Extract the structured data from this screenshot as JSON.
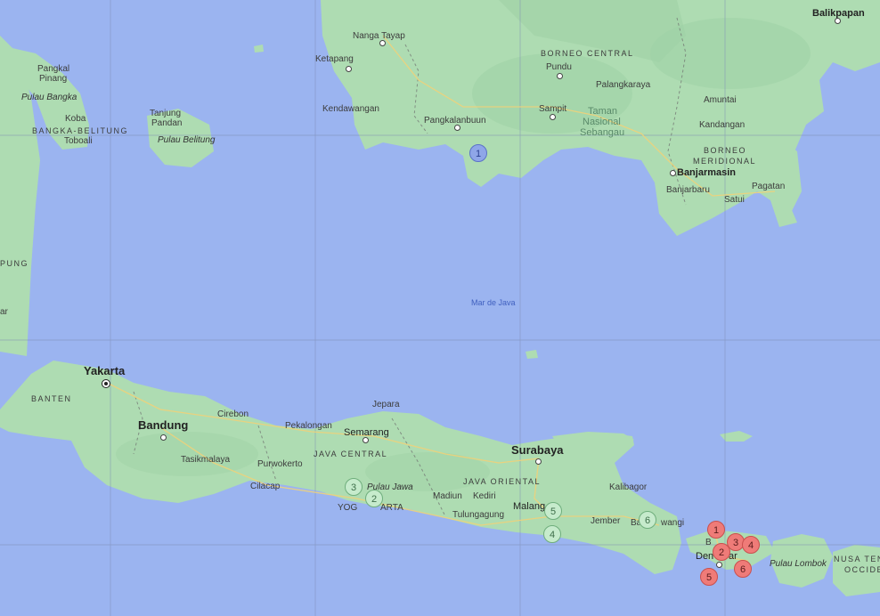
{
  "map": {
    "water_labels": {
      "java_sea": "Mar de Java"
    },
    "regions": {
      "borneo_central": "BORNEO CENTRAL",
      "borneo_meridional_1": "BORNEO",
      "borneo_meridional_2": "MERIDIONAL",
      "bangka_belitung": "BANGKA-BELITUNG",
      "banten": "BANTEN",
      "java_central": "JAVA CENTRAL",
      "java_oriental": "JAVA ORIENTAL",
      "nusa_1": "NUSA TEN",
      "nusa_2": "OCCIDE",
      "lampung": "PUNG"
    },
    "islands": {
      "bangka": "Pulau Bangka",
      "belitung": "Pulau Belitung",
      "jawa": "Pulau Jawa",
      "lombok": "Pulau Lombok"
    },
    "park": {
      "line1": "Taman",
      "line2": "Nasional",
      "line3": "Sebangau"
    },
    "cities": {
      "balikpapan": "Balikpapan",
      "nanga_tayap": "Nanga Tayap",
      "ketapang": "Ketapang",
      "kendawangan": "Kendawangan",
      "pangkalanbuun": "Pangkalanbuun",
      "pundu": "Pundu",
      "palangkaraya": "Palangkaraya",
      "sampit": "Sampit",
      "amuntai": "Amuntai",
      "kandangan": "Kandangan",
      "banjarmasin": "Banjarmasin",
      "banjarbaru": "Banjarbaru",
      "pagatan": "Pagatan",
      "satui": "Satui",
      "pangkal_pinang_1": "Pangkal",
      "pangkal_pinang_2": "Pinang",
      "koba": "Koba",
      "toboali": "Toboali",
      "tanjung_pandan_1": "Tanjung",
      "tanjung_pandan_2": "Pandan",
      "yakarta": "Yakarta",
      "bandung": "Bandung",
      "cirebon": "Cirebon",
      "jepara": "Jepara",
      "pekalongan": "Pekalongan",
      "semarang": "Semarang",
      "tasikmalaya": "Tasikmalaya",
      "purwokerto": "Purwokerto",
      "cilacap": "Cilacap",
      "yogyakarta_a": "YOG",
      "yogyakarta_b": "ARTA",
      "surabaya": "Surabaya",
      "madiun": "Madiun",
      "kediri": "Kediri",
      "tulungagung": "Tulungagung",
      "malang": "Malang",
      "jember": "Jember",
      "kalibagor": "Kalibagor",
      "banyuwangi_a": "Ba",
      "banyuwangi_b": "wangi",
      "denpasar_a": "Den",
      "denpasar_b": "ar",
      "bali_a": "B",
      "lampung_city": "ar"
    },
    "markers": [
      {
        "label": "1",
        "color": "blue"
      },
      {
        "label": "3",
        "color": "green"
      },
      {
        "label": "2",
        "color": "green"
      },
      {
        "label": "5",
        "color": "green"
      },
      {
        "label": "4",
        "color": "green"
      },
      {
        "label": "6",
        "color": "green"
      },
      {
        "label": "1",
        "color": "red"
      },
      {
        "label": "3",
        "color": "red"
      },
      {
        "label": "4",
        "color": "red"
      },
      {
        "label": "2",
        "color": "red"
      },
      {
        "label": "5",
        "color": "red"
      },
      {
        "label": "6",
        "color": "red"
      }
    ]
  }
}
